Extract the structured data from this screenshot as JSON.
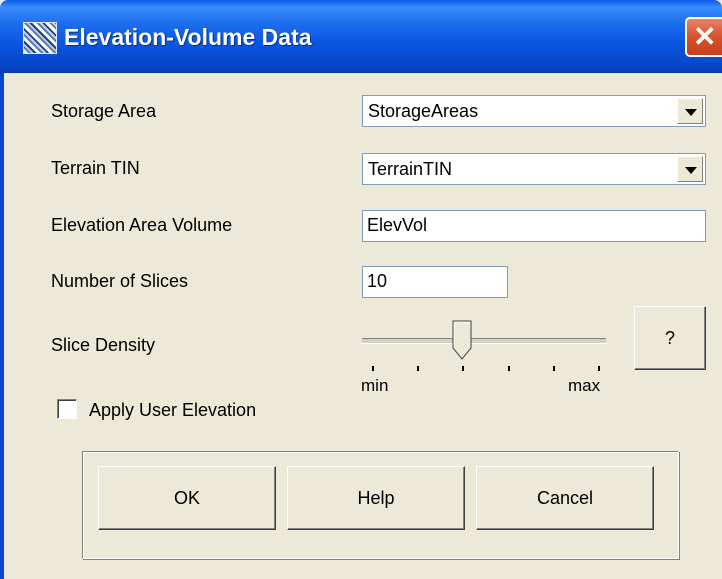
{
  "window": {
    "title": "Elevation-Volume Data",
    "app_icon": "terrain-map-icon",
    "close_glyph": "✕"
  },
  "fields": {
    "storage_area": {
      "label": "Storage Area",
      "value": "StorageAreas"
    },
    "terrain_tin": {
      "label": "Terrain TIN",
      "value": "TerrainTIN"
    },
    "elevation_area_volume": {
      "label": "Elevation Area Volume",
      "value": "ElevVol"
    },
    "number_of_slices": {
      "label": "Number of Slices",
      "value": "10"
    },
    "slice_density": {
      "label": "Slice Density",
      "min_label": "min",
      "max_label": "max",
      "level": 0.4,
      "tick_count": 6
    },
    "apply_user_elevation": {
      "label": "Apply User Elevation",
      "checked": false
    }
  },
  "buttons": {
    "help_question": "?",
    "ok": "OK",
    "help": "Help",
    "cancel": "Cancel"
  }
}
